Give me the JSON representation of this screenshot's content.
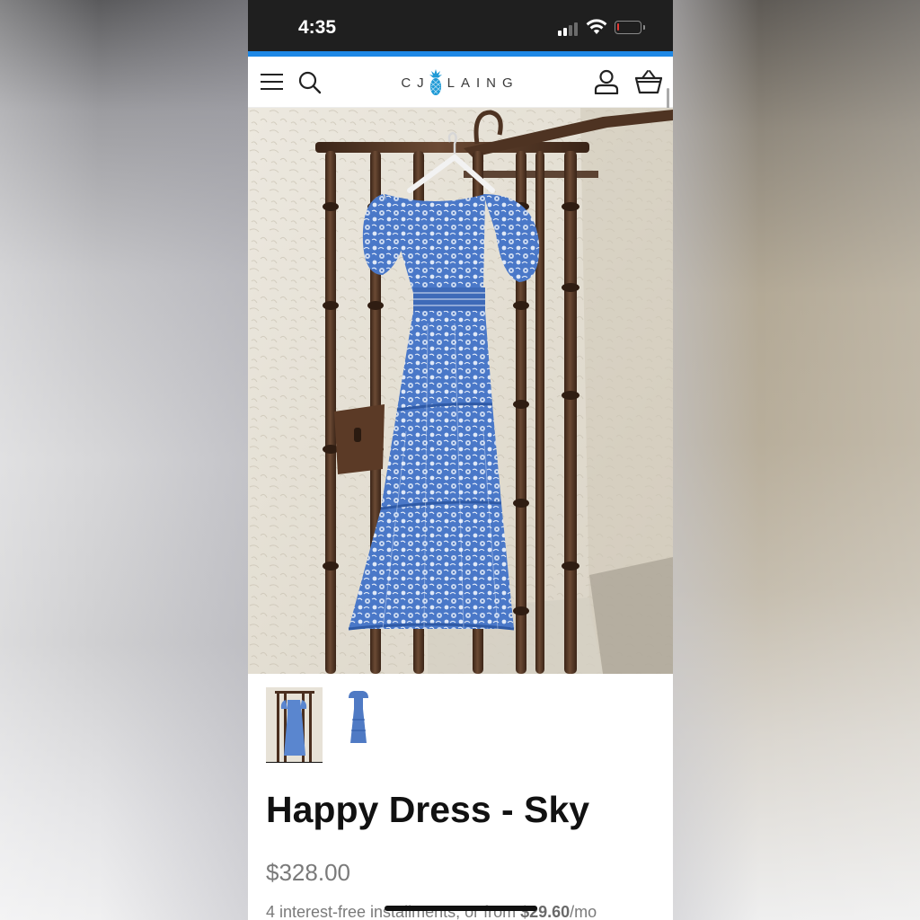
{
  "status_bar": {
    "time": "4:35",
    "signal_icon": "cellular-signal-icon",
    "wifi_icon": "wifi-icon",
    "battery_icon": "battery-low-icon",
    "battery_level": 0.1
  },
  "colors": {
    "accent": "#1e88e5",
    "battery_low": "#e53935",
    "logo_pineapple": "#1e9ad6",
    "text_primary": "#111111",
    "text_muted": "#7a7a7a"
  },
  "header": {
    "menu_icon": "hamburger-menu-icon",
    "search_icon": "search-icon",
    "logo_left": "CJ",
    "logo_right": "LAING",
    "logo_icon": "pineapple-icon",
    "account_icon": "user-account-icon",
    "cart_icon": "shopping-basket-icon"
  },
  "gallery": {
    "thumbnails": [
      {
        "label": "Dress hanging on iron gate",
        "active": true
      },
      {
        "label": "Dress front view",
        "active": false
      }
    ]
  },
  "product": {
    "title": "Happy Dress - Sky",
    "price": "$328.00",
    "installments_prefix": "4 interest-free installments, or from ",
    "installments_amount": "$29.60",
    "installments_suffix": "/mo"
  }
}
